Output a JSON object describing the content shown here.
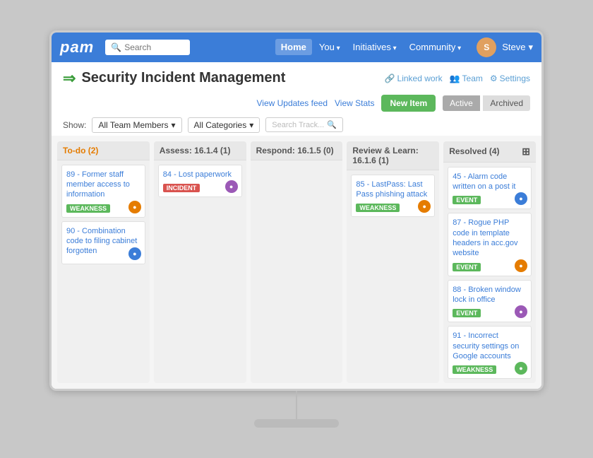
{
  "nav": {
    "logo": "pam",
    "search_placeholder": "Search",
    "links": [
      {
        "label": "Home",
        "active": true
      },
      {
        "label": "You",
        "dropdown": true
      },
      {
        "label": "Initiatives",
        "dropdown": true
      },
      {
        "label": "Community",
        "dropdown": true
      }
    ],
    "user_label": "Steve",
    "user_avatar": "S"
  },
  "page": {
    "title": "Security Incident Management",
    "icon": "⇒",
    "linked_work": "Linked work",
    "team": "Team",
    "settings": "Settings"
  },
  "toolbar": {
    "view_updates": "View Updates feed",
    "view_stats": "View Stats",
    "new_item": "New Item",
    "active": "Active",
    "archived": "Archived"
  },
  "filters": {
    "show_label": "Show:",
    "team_members": "All Team Members",
    "categories": "All Categories",
    "search_placeholder": "Search Track..."
  },
  "columns": [
    {
      "id": "todo",
      "title": "To-do (2)",
      "color_class": "todo",
      "cards": [
        {
          "id": "89",
          "title": "89 - Former staff member access to information",
          "badge": "WEAKNESS",
          "badge_class": "badge-weakness",
          "avatar_class": "orange"
        },
        {
          "id": "90",
          "title": "90 - Combination code to filing cabinet forgotten",
          "badge": null,
          "avatar_class": "blue"
        }
      ]
    },
    {
      "id": "assess",
      "title": "Assess: 16.1.4 (1)",
      "color_class": "assess",
      "cards": [
        {
          "id": "84",
          "title": "84 - Lost paperwork",
          "badge": "INCIDENT",
          "badge_class": "badge-incident",
          "avatar_class": "purple"
        }
      ]
    },
    {
      "id": "respond",
      "title": "Respond: 16.1.5 (0)",
      "color_class": "respond",
      "cards": []
    },
    {
      "id": "review",
      "title": "Review & Learn: 16.1.6 (1)",
      "color_class": "review",
      "cards": [
        {
          "id": "85",
          "title": "85 - LastPass: Last Pass phishing attack",
          "badge": "WEAKNESS",
          "badge_class": "badge-weakness",
          "avatar_class": "orange"
        }
      ]
    },
    {
      "id": "resolved",
      "title": "Resolved (4)",
      "color_class": "resolved",
      "cards": [
        {
          "id": "45",
          "title": "45 - Alarm code written on a post it",
          "badge": "EVENT",
          "badge_class": "badge-event",
          "avatar_class": "blue"
        },
        {
          "id": "87",
          "title": "87 - Rogue PHP code in template headers in acc.gov website",
          "badge": "EVENT",
          "badge_class": "badge-event",
          "avatar_class": "orange"
        },
        {
          "id": "88",
          "title": "88 - Broken window lock in office",
          "badge": "EVENT",
          "badge_class": "badge-event",
          "avatar_class": "purple"
        },
        {
          "id": "91",
          "title": "91 - Incorrect security settings on Google accounts",
          "badge": "WEAKNESS",
          "badge_class": "badge-weakness",
          "avatar_class": "green"
        }
      ]
    }
  ]
}
